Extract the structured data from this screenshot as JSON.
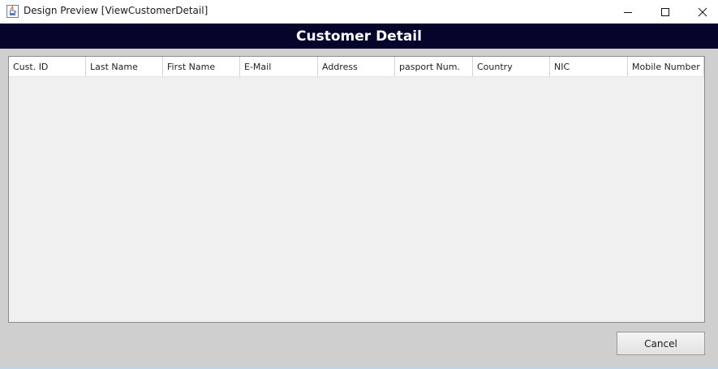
{
  "window": {
    "title": "Design Preview [ViewCustomerDetail]",
    "icon": "java-cup-icon",
    "controls": [
      "minimize-icon",
      "maximize-icon",
      "close-icon"
    ]
  },
  "banner": {
    "title": "Customer Detail",
    "background": "#05052b",
    "color": "#ffffff"
  },
  "table": {
    "columns": [
      "Cust. ID",
      "Last  Name",
      "First  Name",
      "E-Mail",
      "Address",
      "pasport Num.",
      "Country",
      "NIC",
      "Mobile Number"
    ],
    "rows": []
  },
  "actions": {
    "cancel_label": "Cancel"
  }
}
